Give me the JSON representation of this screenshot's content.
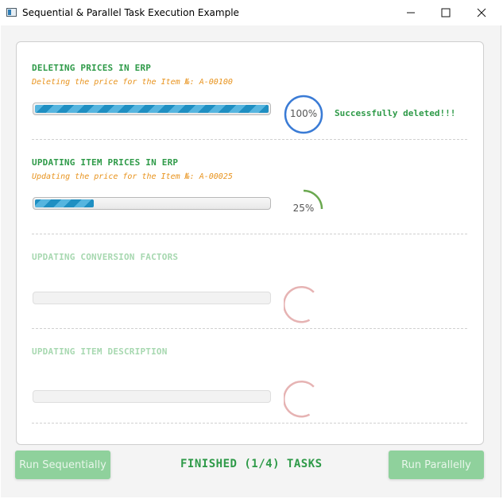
{
  "window": {
    "title": "Sequential & Parallel Task Execution Example"
  },
  "tasks": [
    {
      "title": "DELETING PRICES IN ERP",
      "message": "Deleting the price for the Item №: A-00100",
      "progress": 1.0,
      "percent_label": "100%",
      "result": "Successfully deleted!!!",
      "state": "completed"
    },
    {
      "title": "UPDATING ITEM PRICES IN ERP",
      "message": "Updating the price for the Item №: A-00025",
      "progress": 0.25,
      "percent_label": "25%",
      "result": "",
      "state": "running"
    },
    {
      "title": "UPDATING CONVERSION FACTORS",
      "message": "",
      "progress": 0,
      "percent_label": "",
      "result": "",
      "state": "pending"
    },
    {
      "title": "UPDATING ITEM DESCRIPTION",
      "message": "",
      "progress": 0,
      "percent_label": "",
      "result": "",
      "state": "pending"
    }
  ],
  "footer": {
    "run_sequential_label": "Run Sequentially",
    "status_text": "FINISHED (1/4) TASKS",
    "run_parallel_label": "Run Parallelly"
  },
  "colors": {
    "success_green": "#2e9a48",
    "message_orange": "#e8931d",
    "progress_blue": "#1f8fc2",
    "ring_blue": "#3a7bd5",
    "ring_green": "#6aa84f",
    "ring_pending": "#e6b3b3",
    "button_disabled": "#8fd19c"
  },
  "icons": {
    "app": "app-window-icon",
    "minimize": "minimize-icon",
    "maximize": "maximize-icon",
    "close": "close-icon"
  }
}
